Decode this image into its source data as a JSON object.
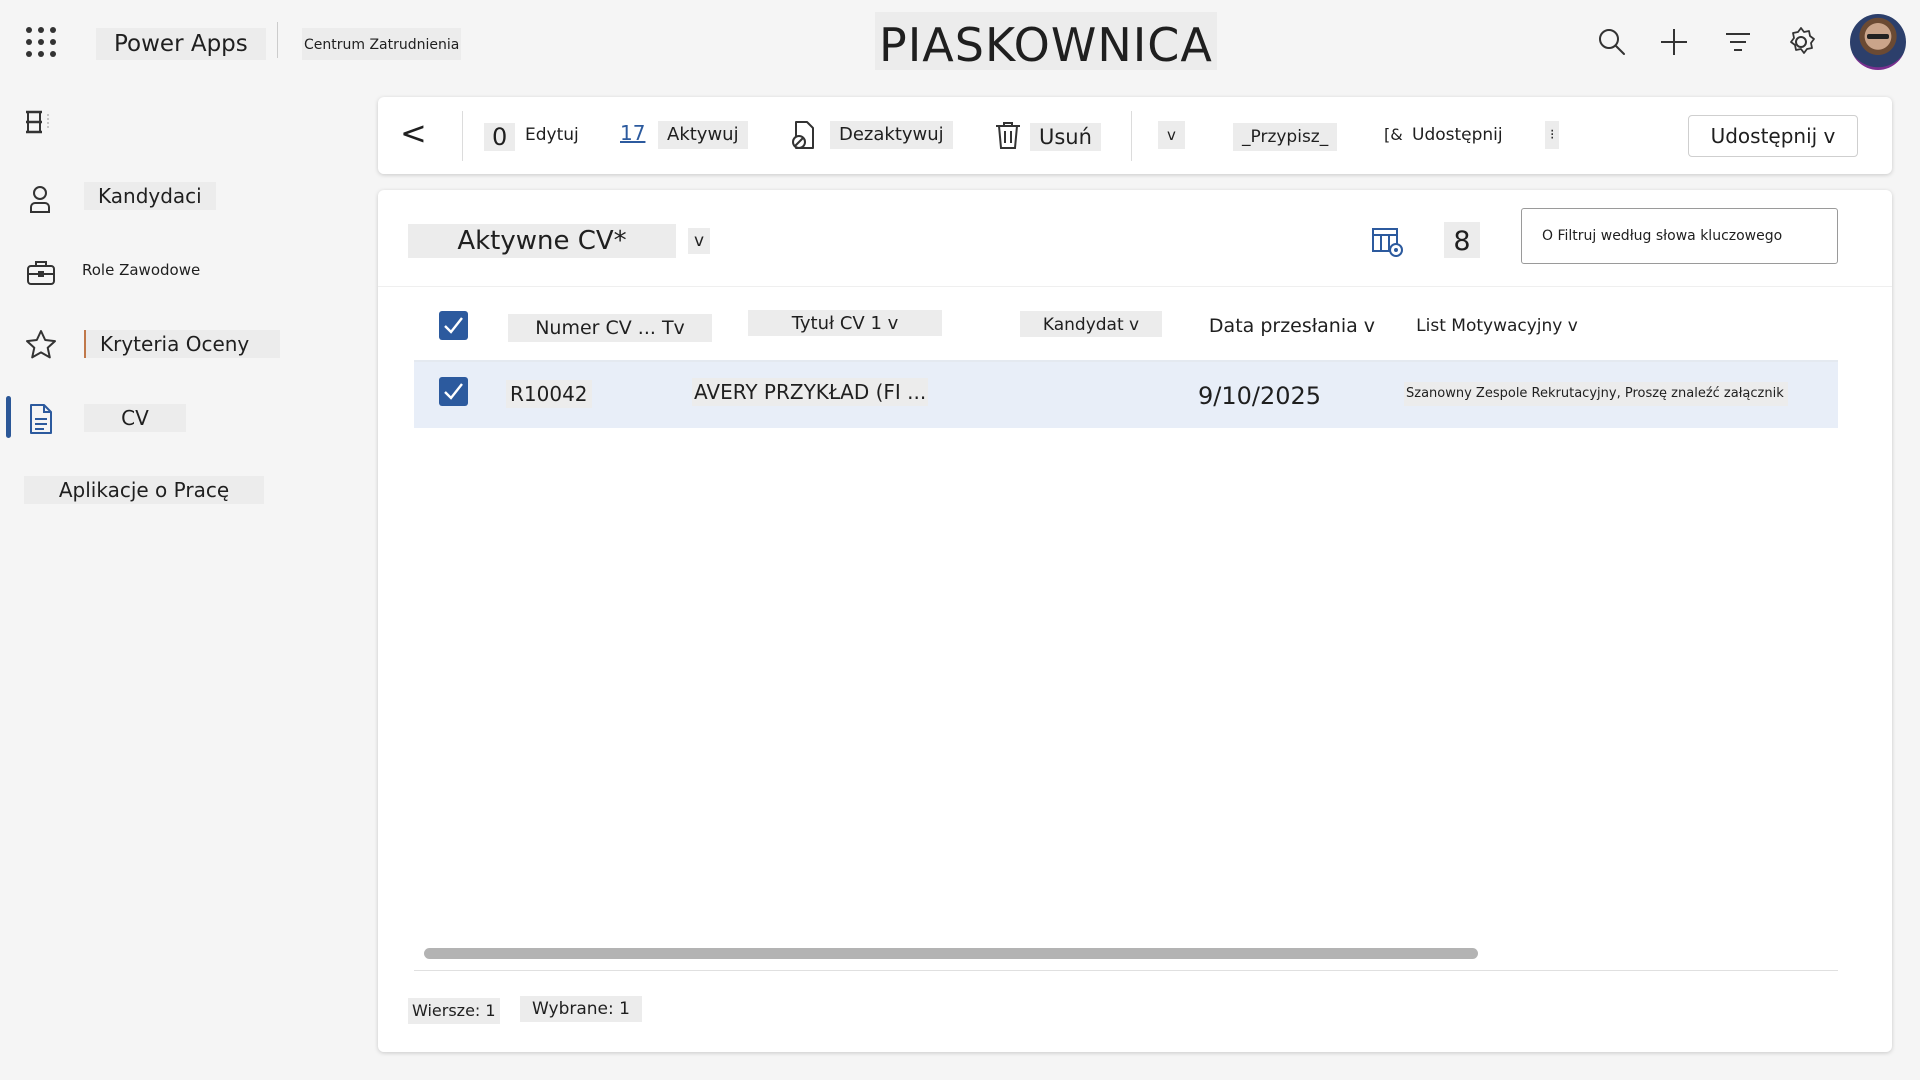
{
  "app": {
    "name": "Power Apps",
    "subtitle": "Centrum Zatrudnienia",
    "environment": "PIASKOWNICA"
  },
  "header": {
    "icons": [
      "search-icon",
      "add-icon",
      "filter-icon",
      "settings-icon"
    ]
  },
  "sidebar": {
    "items": [
      {
        "label": "Kandydaci",
        "icon": "person-icon"
      },
      {
        "label": "Role Zawodowe",
        "icon": "briefcase-icon"
      },
      {
        "label": "Kryteria Oceny",
        "icon": "star-icon"
      },
      {
        "label": "CV",
        "icon": "document-icon",
        "active": true
      },
      {
        "label": "Aplikacje o Pracę",
        "icon": "none"
      }
    ]
  },
  "commandbar": {
    "back": "<",
    "edit_prefix": "0",
    "edit": "Edytuj",
    "activate_prefix": "17",
    "activate": "Aktywuj",
    "deactivate": "Dezaktywuj",
    "delete": "Usuń",
    "more_caret": "v",
    "assign": "_Przypisz_",
    "share_prefix": "[&",
    "share": "Udostępnij",
    "overflow": "⁝",
    "share_button": "Udostępnij v"
  },
  "view": {
    "title": "Aktywne CV*",
    "caret": "v",
    "record_count": "8",
    "search_placeholder": "O Filtruj według słowa kluczowego"
  },
  "grid": {
    "columns": [
      "Numer CV ... Tv",
      "Tytuł CV 1 v",
      "Kandydat v",
      "Data przesłania v",
      "List Motywacyjny v"
    ],
    "rows": [
      {
        "selected": true,
        "cv_number": "R10042",
        "cv_title": "AVERY PRZYKŁAD (FI ...",
        "candidate": "",
        "submitted": "9/10/2025",
        "cover_letter": "Szanowny Zespole Rekrutacyjny, Proszę znaleźć załącznik ..."
      }
    ]
  },
  "footer": {
    "rows": "Wiersze: 1",
    "selected": "Wybrane: 1"
  },
  "colors": {
    "accent": "#2c5a9e",
    "row_selected": "#e8eef8",
    "background": "#f5f5f5"
  }
}
